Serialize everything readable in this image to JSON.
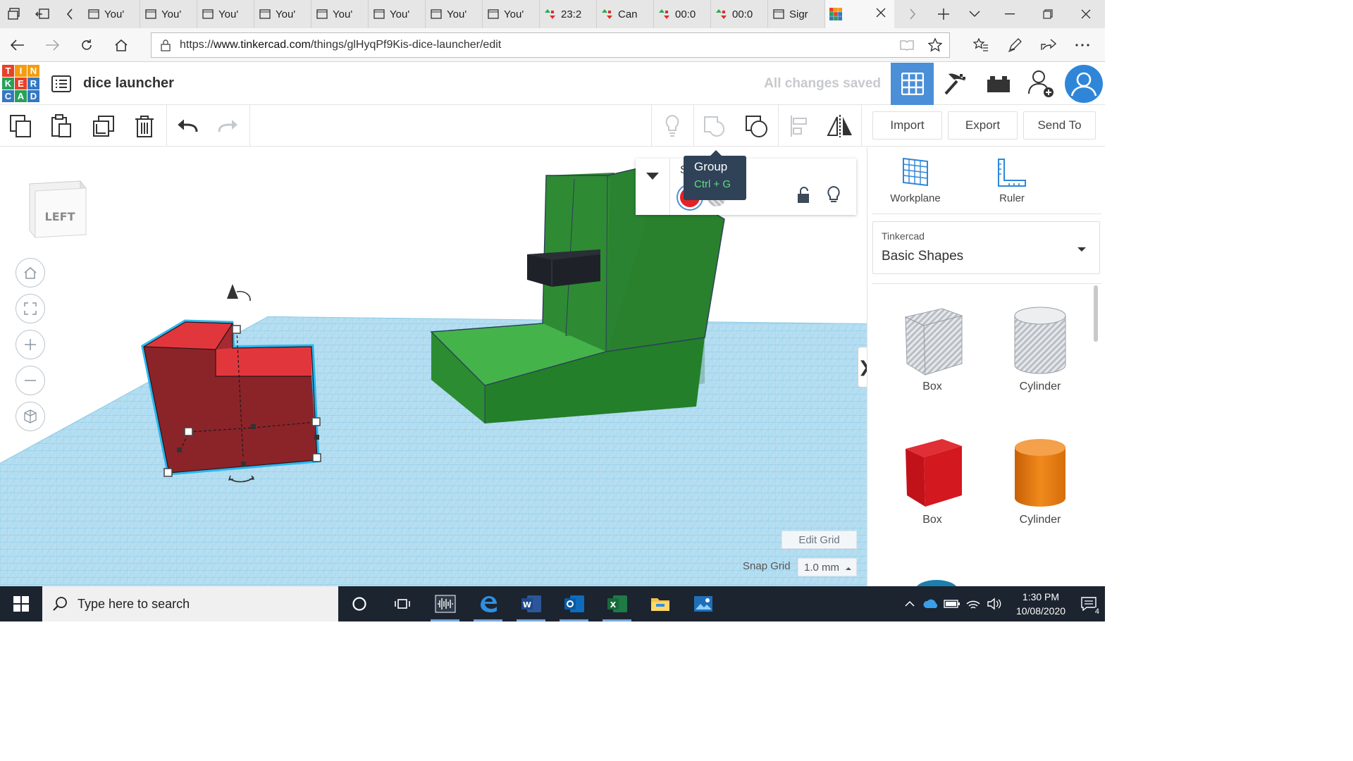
{
  "browser": {
    "tabs": [
      {
        "label": "You'",
        "icon": "page-icon"
      },
      {
        "label": "You'",
        "icon": "page-icon"
      },
      {
        "label": "You'",
        "icon": "page-icon"
      },
      {
        "label": "You'",
        "icon": "page-icon"
      },
      {
        "label": "You'",
        "icon": "page-icon"
      },
      {
        "label": "You'",
        "icon": "page-icon"
      },
      {
        "label": "You'",
        "icon": "page-icon"
      },
      {
        "label": "You'",
        "icon": "page-icon"
      },
      {
        "label": "23:2",
        "icon": "stock-icon"
      },
      {
        "label": "Can",
        "icon": "stock-icon"
      },
      {
        "label": "00:0",
        "icon": "stock-icon"
      },
      {
        "label": "00:0",
        "icon": "stock-icon"
      },
      {
        "label": "Sigr",
        "icon": "page-icon"
      }
    ],
    "active_tab_icon": "tinkercad-favicon",
    "url_prefix": "https://",
    "url_domain": "www.tinkercad.com",
    "url_path": "/things/glHyqPf9Kis-dice-launcher/edit"
  },
  "app": {
    "logo_letters": [
      "T",
      "I",
      "N",
      "K",
      "E",
      "R",
      "C",
      "A",
      "D"
    ],
    "logo_colors": [
      "#e8412a",
      "#f39c12",
      "#f39c12",
      "#27a15a",
      "#e8412a",
      "#3478c1",
      "#3478c1",
      "#27a15a",
      "#3478c1"
    ],
    "design_title": "dice launcher",
    "save_status": "All changes saved"
  },
  "toolbar": {
    "import_label": "Import",
    "export_label": "Export",
    "send_to_label": "Send To"
  },
  "workspace": {
    "viewcube_label": "LEFT",
    "tooltip_title": "Group",
    "tooltip_shortcut": "Ctrl + G",
    "inspector_label": "S",
    "edit_grid_label": "Edit Grid",
    "snap_grid_label": "Snap Grid",
    "snap_grid_value": "1.0 mm",
    "panel_toggle_glyph": "❯"
  },
  "panel": {
    "workplane_label": "Workplane",
    "ruler_label": "Ruler",
    "library_source": "Tinkercad",
    "library_name": "Basic Shapes",
    "shapes": [
      {
        "label": "Box",
        "kind": "box-hole"
      },
      {
        "label": "Cylinder",
        "kind": "cylinder-hole"
      },
      {
        "label": "Box",
        "kind": "box-solid"
      },
      {
        "label": "Cylinder",
        "kind": "cylinder-solid"
      }
    ]
  },
  "taskbar": {
    "search_placeholder": "Type here to search",
    "time": "1:30 PM",
    "date": "10/08/2020",
    "notification_count": "4"
  },
  "colors": {
    "accent_blue": "#4b8fd8",
    "grid_blue": "#a9d8ef",
    "selected_solid_red": "#8b2429",
    "launcher_green": "#2f8a34",
    "tooltip_bg": "#2f4258"
  }
}
